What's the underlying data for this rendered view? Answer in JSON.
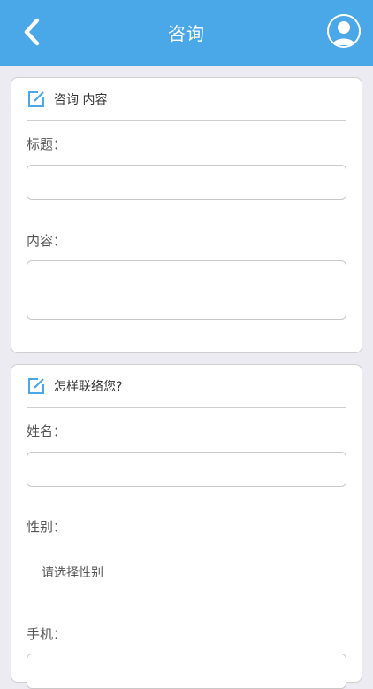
{
  "header": {
    "title": "咨询"
  },
  "icons": {
    "back": "chevron-left-icon",
    "user": "user-avatar-icon",
    "edit": "edit-icon"
  },
  "colors": {
    "header_bg": "#4aa7e8",
    "accent": "#4aa7e8",
    "page_bg": "#ecebf1"
  },
  "consult_section": {
    "title": "咨询 内容",
    "fields": [
      {
        "label": "标题：",
        "value": ""
      },
      {
        "label": "内容：",
        "value": ""
      }
    ]
  },
  "contact_section": {
    "title": "怎样联络您?",
    "name_label": "姓名：",
    "name_value": "",
    "gender_label": "性别：",
    "gender_placeholder": "请选择性别",
    "phone_label": "手机：",
    "phone_value": ""
  }
}
